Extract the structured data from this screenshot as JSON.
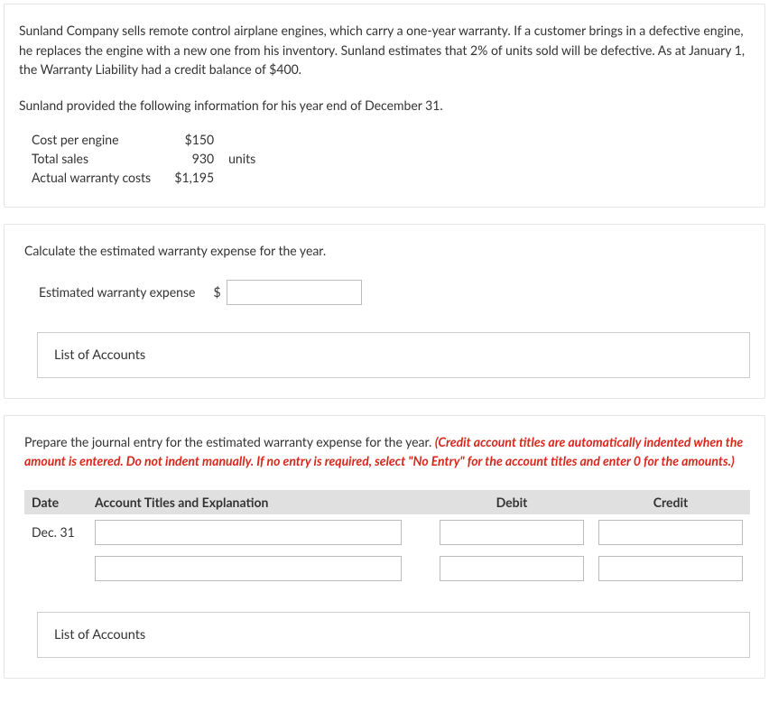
{
  "panel1": {
    "intro": "Sunland Company sells remote control airplane engines, which carry a one-year warranty. If a customer brings in a defective engine, he replaces the engine with a new one from his inventory. Sunland estimates that 2% of units sold will be defective. As at January 1, the Warranty Liability had a credit balance of $400.",
    "sub": "Sunland provided the following information for his year end of December 31.",
    "rows": {
      "r1": {
        "label": "Cost per engine",
        "value": "$150",
        "unit": ""
      },
      "r2": {
        "label": "Total sales",
        "value": "930",
        "unit": "units"
      },
      "r3": {
        "label": "Actual warranty costs",
        "value": "$1,195",
        "unit": ""
      }
    }
  },
  "panel2": {
    "instruction": "Calculate the estimated warranty expense for the year.",
    "inputLabel": "Estimated warranty expense",
    "dollar": "$",
    "buttonLabel": "List of Accounts"
  },
  "panel3": {
    "instruction_black": "Prepare the journal entry for the estimated warranty expense for the year. ",
    "instruction_red": "(Credit account titles are automatically indented when the amount is entered. Do not indent manually. If no entry is required, select \"No Entry\" for the account titles and enter 0 for the amounts.)",
    "headers": {
      "date": "Date",
      "account": "Account Titles and Explanation",
      "debit": "Debit",
      "credit": "Credit"
    },
    "date1": "Dec. 31",
    "buttonLabel": "List of Accounts"
  }
}
